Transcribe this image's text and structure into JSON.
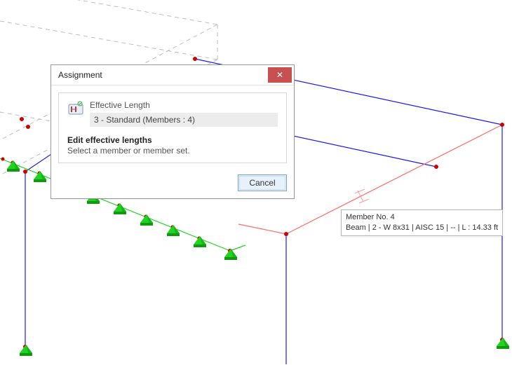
{
  "dialog": {
    "title": "Assignment",
    "close_glyph": "✕",
    "section_title": "Effective Length",
    "selection": "3 - Standard (Members : 4)",
    "message_title": "Edit effective lengths",
    "message_body": "Select a member or member set.",
    "cancel_label": "Cancel"
  },
  "tooltip": {
    "line1": "Member No. 4",
    "line2": "Beam | 2 - W 8x31 | AISC 15 | -- | L : 14.33 ft"
  },
  "colors": {
    "blue_member": "#1a1af0",
    "red_member": "#ff6a6a",
    "green_support": "#1fd31f",
    "node": "#d00000",
    "dashed": "#bdbdbd"
  }
}
